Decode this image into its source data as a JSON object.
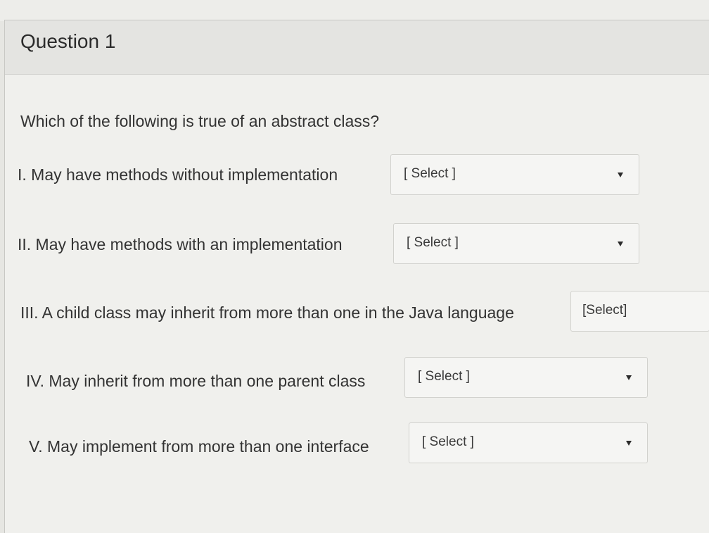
{
  "question": {
    "title": "Question 1",
    "prompt": "Which of the following is true of an abstract class?",
    "rows": [
      {
        "label": "I. May have methods without implementation",
        "select": "[ Select ]"
      },
      {
        "label": "II. May have methods with an implementation",
        "select": "[ Select ]"
      },
      {
        "label": "III. A child class may inherit from more than one in the Java language",
        "select": "[Select]"
      },
      {
        "label": "IV. May inherit from more than one parent class",
        "select": "[ Select ]"
      },
      {
        "label": "V. May implement from more than one interface",
        "select": "[ Select ]"
      }
    ]
  },
  "icons": {
    "dropdown": "caret-down-icon"
  }
}
